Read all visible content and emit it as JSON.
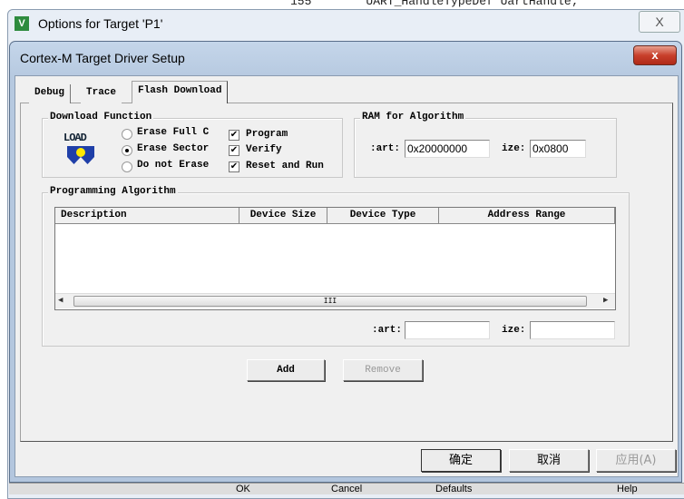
{
  "background": {
    "line_number": "155",
    "code": "UART_HandleTypeDef UartHandle;",
    "buttons": [
      "OK",
      "Cancel",
      "Defaults",
      "Help"
    ]
  },
  "outer_window": {
    "title": "Options for Target 'P1'",
    "close": "X"
  },
  "dialog": {
    "title": "Cortex-M Target Driver Setup",
    "close": "x"
  },
  "tabs": [
    {
      "label": "Debug",
      "selected": false
    },
    {
      "label": "Trace",
      "selected": false
    },
    {
      "label": "Flash Download",
      "selected": true
    }
  ],
  "download_function": {
    "label": "Download Function",
    "icon_text": "LOAD",
    "erase_options": [
      {
        "label": "Erase Full C",
        "checked": false
      },
      {
        "label": "Erase Sector",
        "checked": true
      },
      {
        "label": "Do not Erase",
        "checked": false
      }
    ],
    "checks": [
      {
        "label": "Program",
        "checked": true
      },
      {
        "label": "Verify",
        "checked": true
      },
      {
        "label": "Reset and Run",
        "checked": true
      }
    ]
  },
  "ram": {
    "label": "RAM for Algorithm",
    "start_label": ":art:",
    "start_value": "0x20000000",
    "size_label": "ize:",
    "size_value": "0x0800"
  },
  "programming": {
    "label": "Programming Algorithm",
    "columns": [
      "Description",
      "Device Size",
      "Device Type",
      "Address Range"
    ],
    "rows": [],
    "start_label": ":art:",
    "start_value": "",
    "size_label": "ize:",
    "size_value": "",
    "scroll_grip": "III"
  },
  "buttons": {
    "add": "Add",
    "remove": "Remove",
    "ok": "确定",
    "cancel": "取消",
    "apply": "应用(A)"
  }
}
